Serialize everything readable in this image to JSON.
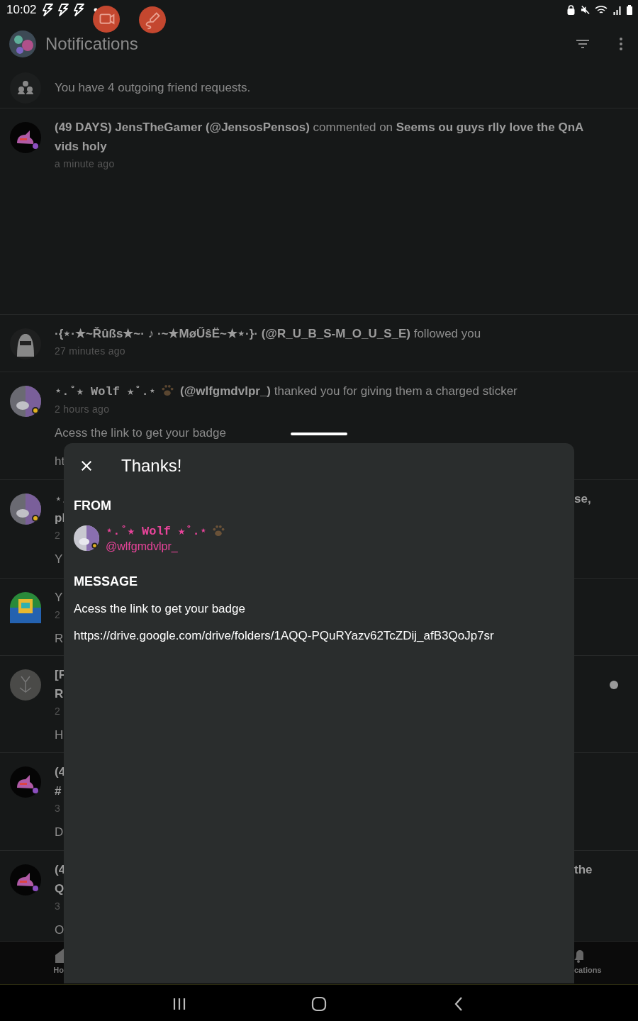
{
  "status_bar": {
    "time": "10:02"
  },
  "header": {
    "title": "Notifications"
  },
  "friend_requests": {
    "text": "You have 4 outgoing friend requests."
  },
  "notifications": [
    {
      "unread": false,
      "lines": [
        {
          "kind": "title",
          "segments": [
            {
              "kind": "bold",
              "text": "(49 DAYS) JensTheGamer (@JensosPensos)"
            },
            {
              "kind": "plain",
              "text": " commented on "
            },
            {
              "kind": "bold",
              "text": "Seems ou guys rlly love the QnA vids holy"
            }
          ]
        },
        {
          "kind": "time",
          "text": "a minute ago"
        }
      ]
    },
    {
      "unread": false,
      "lines": [
        {
          "kind": "title",
          "segments": [
            {
              "kind": "bold",
              "text": "·{⋆·★~Řûßs★~· ♪ ·~★MøŰŝË~★⋆·}· (@R_U_B_S-M_O_U_S_E)"
            },
            {
              "kind": "plain",
              "text": " followed you"
            }
          ]
        },
        {
          "kind": "time",
          "text": "27 minutes ago"
        }
      ]
    },
    {
      "unread": false,
      "lines": [
        {
          "kind": "title",
          "segments": [
            {
              "kind": "mono",
              "text": "⋆.˚★ Wolf ★˚.⋆"
            },
            {
              "kind": "paw"
            },
            {
              "kind": "bold",
              "text": "(@wlfgmdvlpr_)"
            },
            {
              "kind": "plain",
              "text": " thanked you for giving them a charged sticker"
            }
          ]
        },
        {
          "kind": "time",
          "text": "2 hours ago"
        },
        {
          "kind": "body",
          "text": "Acess the link to get your badge"
        },
        {
          "kind": "body",
          "text": "ht"
        }
      ]
    },
    {
      "unread": false,
      "lines": [
        {
          "kind": "title",
          "segments": [
            {
              "kind": "plain",
              "text": "⋆."
            }
          ],
          "right": "se,"
        },
        {
          "kind": "title",
          "segments": [
            {
              "kind": "bold",
              "text": "pl"
            }
          ]
        },
        {
          "kind": "time",
          "text": "2"
        },
        {
          "kind": "body",
          "text": "Y"
        }
      ]
    },
    {
      "unread": false,
      "lines": [
        {
          "kind": "title",
          "segments": [
            {
              "kind": "plain",
              "text": "Y"
            }
          ]
        },
        {
          "kind": "time",
          "text": "2"
        },
        {
          "kind": "body",
          "text": "R"
        }
      ]
    },
    {
      "unread": true,
      "lines": [
        {
          "kind": "title",
          "segments": [
            {
              "kind": "bold",
              "text": "[F"
            }
          ]
        },
        {
          "kind": "title",
          "segments": [
            {
              "kind": "bold",
              "text": "R"
            }
          ]
        },
        {
          "kind": "time",
          "text": "2"
        },
        {
          "kind": "body",
          "text": "H"
        }
      ]
    },
    {
      "unread": false,
      "lines": [
        {
          "kind": "title",
          "segments": [
            {
              "kind": "bold",
              "text": "(4"
            }
          ]
        },
        {
          "kind": "title",
          "segments": [
            {
              "kind": "bold",
              "text": "#"
            }
          ]
        },
        {
          "kind": "time",
          "text": "3"
        },
        {
          "kind": "body",
          "text": "D"
        }
      ]
    },
    {
      "unread": false,
      "lines": [
        {
          "kind": "title",
          "segments": [
            {
              "kind": "bold",
              "text": "(4"
            }
          ],
          "right": "the"
        },
        {
          "kind": "title",
          "segments": [
            {
              "kind": "bold",
              "text": "Q"
            }
          ]
        },
        {
          "kind": "time",
          "text": "3"
        },
        {
          "kind": "body",
          "text": "O"
        }
      ]
    }
  ],
  "bottom_nav": [
    {
      "label": "Ho"
    },
    {
      "label": "cations"
    }
  ],
  "sheet": {
    "title": "Thanks!",
    "from_heading": "FROM",
    "sender": {
      "name": "⋆.˚★ Wolf ★˚.⋆",
      "handle": "@wlfgmdvlpr_"
    },
    "message_heading": "MESSAGE",
    "message": [
      "Acess the link to get your badge",
      "https://drive.google.com/drive/folders/1AQQ-PQuRYazv62TcZDij_afB3QoJp7sr"
    ]
  }
}
